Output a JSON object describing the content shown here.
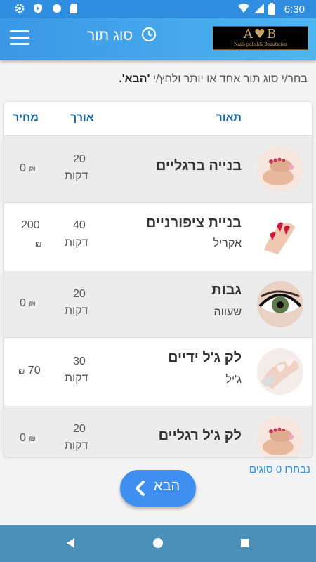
{
  "status_bar": {
    "time": "6:30"
  },
  "header": {
    "title": "סוג תור",
    "logo_text": "A♥B",
    "logo_subtext": "Nails polish& Beauticien"
  },
  "instruction": {
    "text_before": "בחר/י סוג תור אחד או יותר ולחץ/י ",
    "emphasis": "'הבא'."
  },
  "table": {
    "headers": {
      "description": "תאור",
      "duration": "אורך",
      "price": "מחיר"
    },
    "rows": [
      {
        "name": "בנייה ברגליים",
        "sub": "",
        "duration": "20",
        "unit": "דקות",
        "price": "0",
        "currency": "₪"
      },
      {
        "name": "בניית ציפורניים",
        "sub": "אקריל",
        "duration": "40",
        "unit": "דקות",
        "price": "200",
        "currency": "₪"
      },
      {
        "name": "גבות",
        "sub": "שעווה",
        "duration": "20",
        "unit": "דקות",
        "price": "0",
        "currency": "₪"
      },
      {
        "name": "לק ג'ל ידיים",
        "sub": "ג'יל",
        "duration": "30",
        "unit": "דקות",
        "price": "70",
        "currency": "₪"
      },
      {
        "name": "לק ג'ל רגליים",
        "sub": "",
        "duration": "20",
        "unit": "דקות",
        "price": "0",
        "currency": "₪"
      }
    ]
  },
  "selected_count": "נבחרו 0 סוגים",
  "next_button": {
    "label": "הבא"
  },
  "colors": {
    "primary": "#2f8ee0",
    "header_text": "#1a6aa8",
    "button": "#3f8ff0"
  }
}
